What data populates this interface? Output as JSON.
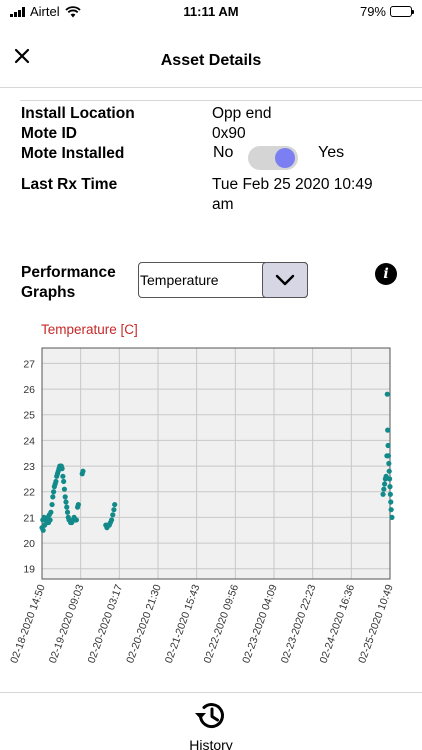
{
  "status_bar": {
    "carrier": "Airtel",
    "time": "11:11 AM",
    "battery": "79%",
    "battery_level": 0.79
  },
  "header": {
    "title": "Asset Details"
  },
  "details": {
    "install_location": {
      "label": "Install Location",
      "value": "Opp end"
    },
    "mote_id": {
      "label": "Mote ID",
      "value": "0x90"
    },
    "mote_installed": {
      "label": "Mote Installed",
      "off_label": "No",
      "on_label": "Yes",
      "checked": true
    },
    "last_rx_time": {
      "label": "Last Rx Time",
      "value_line1": "Tue Feb 25 2020 10:49",
      "value_line2": "am"
    }
  },
  "performance": {
    "label_line1": "Performance",
    "label_line2": "Graphs",
    "selected": "Temperature"
  },
  "chart_data": {
    "type": "scatter",
    "title": "Temperature [C]",
    "ylim": [
      18.6,
      27.6
    ],
    "yticks": [
      19,
      20,
      21,
      22,
      23,
      24,
      25,
      26,
      27
    ],
    "xticks": [
      "02-18-2020 14:50",
      "02-19-2020 09:03",
      "02-20-2020 03:17",
      "02-20-2020 21:30",
      "02-21-2020 15:43",
      "02-22-2020 09:56",
      "02-23-2020 04:09",
      "02-23-2020 22:23",
      "02-24-2020 16:36",
      "02-25-2020 10:49"
    ],
    "grid": true,
    "color": "#138a8a",
    "x_range_index": [
      0,
      9
    ],
    "points": [
      [
        0.0,
        20.6
      ],
      [
        0.02,
        20.9
      ],
      [
        0.03,
        20.5
      ],
      [
        0.05,
        21.0
      ],
      [
        0.07,
        20.7
      ],
      [
        0.09,
        20.9
      ],
      [
        0.11,
        20.9
      ],
      [
        0.13,
        20.8
      ],
      [
        0.15,
        21.0
      ],
      [
        0.17,
        20.8
      ],
      [
        0.19,
        21.1
      ],
      [
        0.21,
        20.9
      ],
      [
        0.23,
        21.2
      ],
      [
        0.26,
        21.5
      ],
      [
        0.28,
        21.8
      ],
      [
        0.3,
        22.0
      ],
      [
        0.32,
        22.2
      ],
      [
        0.34,
        22.3
      ],
      [
        0.36,
        22.4
      ],
      [
        0.38,
        22.6
      ],
      [
        0.4,
        22.7
      ],
      [
        0.42,
        22.8
      ],
      [
        0.44,
        22.9
      ],
      [
        0.46,
        23.0
      ],
      [
        0.48,
        23.0
      ],
      [
        0.5,
        23.0
      ],
      [
        0.52,
        22.9
      ],
      [
        0.54,
        22.6
      ],
      [
        0.56,
        22.4
      ],
      [
        0.58,
        22.1
      ],
      [
        0.6,
        21.8
      ],
      [
        0.62,
        21.6
      ],
      [
        0.64,
        21.4
      ],
      [
        0.66,
        21.2
      ],
      [
        0.68,
        21.0
      ],
      [
        0.7,
        20.9
      ],
      [
        0.74,
        20.8
      ],
      [
        0.77,
        20.8
      ],
      [
        0.8,
        20.9
      ],
      [
        0.83,
        21.0
      ],
      [
        0.86,
        20.9
      ],
      [
        0.89,
        20.9
      ],
      [
        0.92,
        21.4
      ],
      [
        0.94,
        21.5
      ],
      [
        1.04,
        22.7
      ],
      [
        1.06,
        22.8
      ],
      [
        1.65,
        20.7
      ],
      [
        1.68,
        20.6
      ],
      [
        1.71,
        20.7
      ],
      [
        1.74,
        20.7
      ],
      [
        1.77,
        20.8
      ],
      [
        1.8,
        20.9
      ],
      [
        1.83,
        21.1
      ],
      [
        1.86,
        21.3
      ],
      [
        1.88,
        21.5
      ],
      [
        8.82,
        21.9
      ],
      [
        8.84,
        22.1
      ],
      [
        8.86,
        22.3
      ],
      [
        8.88,
        22.5
      ],
      [
        8.9,
        22.6
      ],
      [
        8.92,
        23.4
      ],
      [
        8.93,
        25.8
      ],
      [
        8.94,
        24.4
      ],
      [
        8.95,
        23.8
      ],
      [
        8.96,
        23.4
      ],
      [
        8.97,
        23.1
      ],
      [
        8.98,
        22.8
      ],
      [
        8.99,
        22.5
      ],
      [
        9.0,
        22.2
      ],
      [
        9.01,
        21.9
      ],
      [
        9.02,
        21.6
      ],
      [
        9.03,
        21.3
      ],
      [
        9.05,
        21.0
      ]
    ]
  },
  "bottom_nav": {
    "history_label": "History"
  }
}
